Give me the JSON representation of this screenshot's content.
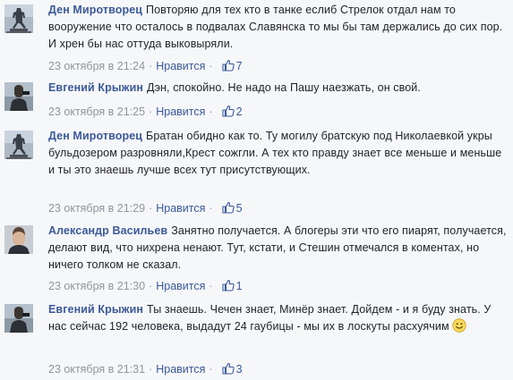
{
  "comments": [
    {
      "author": "Ден Миротворец",
      "text": "Повторяю для тех кто в танке еслиб Стрелок отдал нам то вооружение что осталось в подвалах Славянска то мы бы там держались до сих пор. И хрен бы нас оттуда выковыряли.",
      "timestamp": "23 октября в 21:24",
      "like_label": "Нравится",
      "like_count": "7",
      "avatar": "statue-monument-avatar"
    },
    {
      "author": "Евгений Крыжин",
      "text": "Дэн, спокойно. Не надо на Пашу наезжать, он свой.",
      "timestamp": "23 октября в 21:25",
      "like_label": "Нравится",
      "like_count": "2",
      "avatar": "man-photo-avatar"
    },
    {
      "author": "Ден Миротворец",
      "text": "Братан обидно как то. Ту могилу братскую под Николаевкой укры бульдозером разровняли,Крест сожгли. А тех кто правду знает все меньше и меньше и ты это знаешь лучше всех тут присутствующих.",
      "timestamp": "23 октября в 21:29",
      "like_label": "Нравится",
      "like_count": "5",
      "avatar": "statue-monument-avatar"
    },
    {
      "author": "Александр Васильев",
      "text": "Занятно получается. А блогеры эти что его пиарят, получается, делают вид, что нихрена ненают. Тут, кстати, и Стешин отмечался в коментах, но ничего толком не сказал.",
      "timestamp": "23 октября в 21:30",
      "like_label": "Нравится",
      "like_count": "1",
      "avatar": "man-portrait-avatar"
    },
    {
      "author": "Евгений Крыжин",
      "text": "Ты знаешь. Чечен знает, Минёр знает. Дойдем - и я буду знать. У нас сейчас 192 человека, выдадут 24 гаубицы - мы их в лоскуты расхуячим",
      "timestamp": "23 октября в 21:31",
      "like_label": "Нравится",
      "like_count": "3",
      "avatar": "man-photo-avatar",
      "emoticon": "smile-emoji-icon"
    }
  ]
}
